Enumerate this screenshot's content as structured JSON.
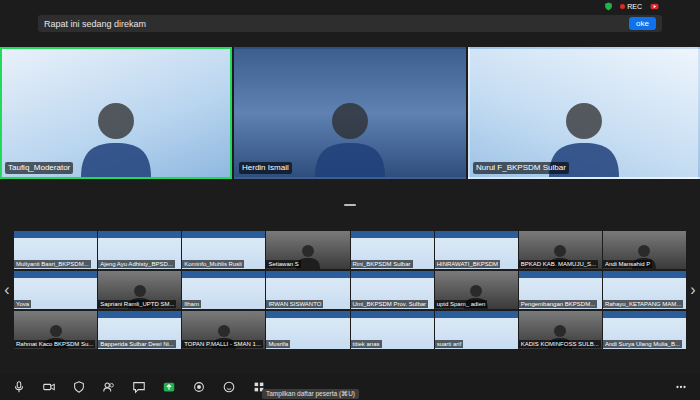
{
  "topbar": {
    "rec": "REC"
  },
  "notice": {
    "text": "Rapat ini sedang direkam",
    "button": "oke"
  },
  "speakers": [
    {
      "name": "Taufiq_Moderator",
      "active": true
    },
    {
      "name": "Herdin Ismail",
      "active": false
    },
    {
      "name": "Nurul F_BKPSDM Sulbar",
      "active": false
    }
  ],
  "gallery": {
    "prev": "‹",
    "next": "›",
    "tiles": [
      {
        "name": "Muliyanti Basri_BKPSDM...",
        "kind": "slide"
      },
      {
        "name": "Ajeng Ayu Adhisty_BPSD...",
        "kind": "slide"
      },
      {
        "name": "Kominfo_Muhlis Rusli",
        "kind": "slide"
      },
      {
        "name": "Setiawan S",
        "kind": "camera"
      },
      {
        "name": "Rini_BKPSDM Sulbar",
        "kind": "slide"
      },
      {
        "name": "HINRAWATI_BKPSDM",
        "kind": "slide"
      },
      {
        "name": "BPKAD KAB. MAMUJU_S...",
        "kind": "camera"
      },
      {
        "name": "Andi Mansahid P",
        "kind": "camera"
      },
      {
        "name": "Yova",
        "kind": "slide"
      },
      {
        "name": "Sapriani Ramli_UPTD SM...",
        "kind": "camera"
      },
      {
        "name": "Ilham",
        "kind": "slide"
      },
      {
        "name": "IRWAN SISWANTO",
        "kind": "slide"
      },
      {
        "name": "Umi_BKPSDM Prov. Sulbar",
        "kind": "slide"
      },
      {
        "name": "uptd Spam_ adien",
        "kind": "camera"
      },
      {
        "name": "Pengembangan BKPSDM...",
        "kind": "slide"
      },
      {
        "name": "Rahayu_KETAPANG MAM...",
        "kind": "slide"
      },
      {
        "name": "Rahmat Kaco BKPSDM Su...",
        "kind": "camera"
      },
      {
        "name": "Bapperida Sulbar Dewi Ni...",
        "kind": "slide"
      },
      {
        "name": "TOPAN P.MALLI - SMAN 1...",
        "kind": "camera"
      },
      {
        "name": "Musrifa",
        "kind": "slide"
      },
      {
        "name": "titiek anas",
        "kind": "slide"
      },
      {
        "name": "suarti arif",
        "kind": "slide"
      },
      {
        "name": "KADIS KOMINFOSS SULB...",
        "kind": "camera"
      },
      {
        "name": "Andi Surya Ulang Mulia_B...",
        "kind": "slide"
      }
    ]
  },
  "toolbar": {
    "tooltip": "Tampilkan daftar peserta (⌘U)"
  }
}
